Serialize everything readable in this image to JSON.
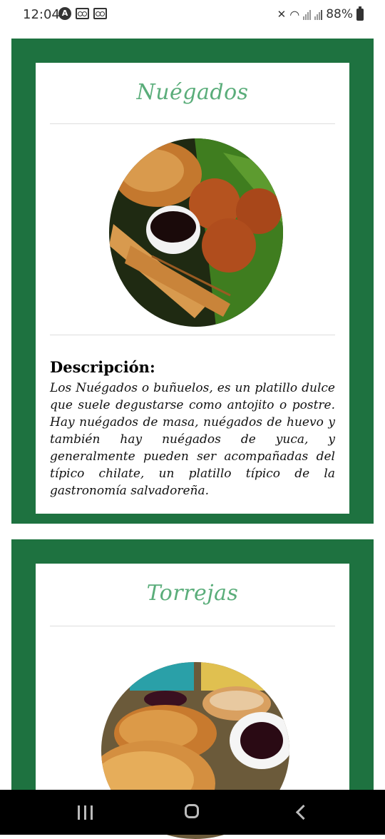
{
  "status_bar": {
    "time": "12:04",
    "battery": "88%",
    "icons": [
      "a-circle-icon",
      "voicemail-icon",
      "voicemail-icon",
      "mute-icon",
      "wifi-icon",
      "signal-icon",
      "signal-icon",
      "battery-icon"
    ]
  },
  "cards": [
    {
      "title": "Nuégados",
      "description_label": "Descripción:",
      "description": "Los Nuégados o buñuelos, es un platillo dulce que suele degustarse como antojito o postre. Hay nuégados de masa, nuégados de huevo y también hay nuégados de yuca, y generalmente pueden ser acompañadas del típico chilate, un platillo típico de la gastronomía salvadoreña."
    },
    {
      "title": "Torrejas"
    }
  ],
  "nav_bar": {
    "buttons": [
      "recent-apps-icon",
      "home-icon",
      "back-icon"
    ]
  },
  "colors": {
    "card_border": "#1e7240",
    "title": "#5aad7a"
  }
}
